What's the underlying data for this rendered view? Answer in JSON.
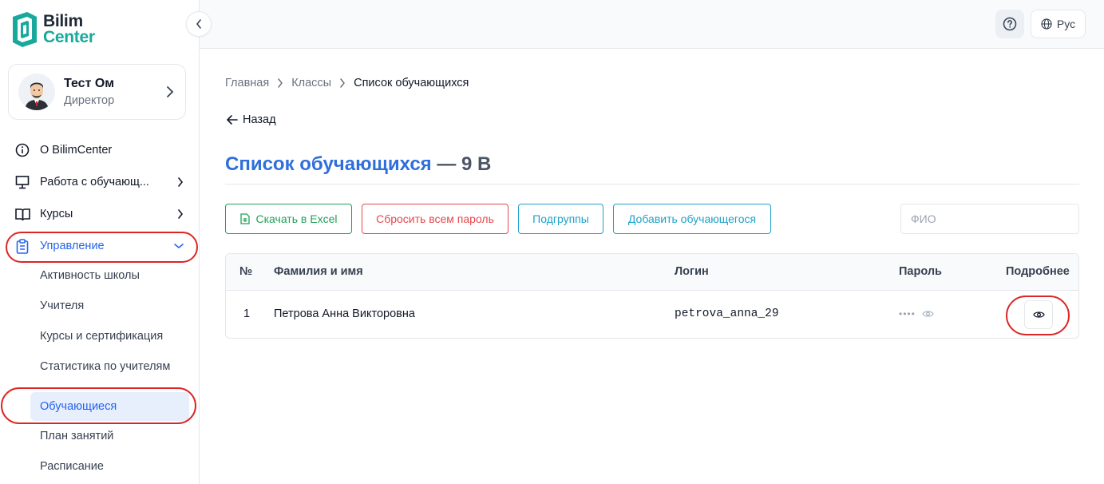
{
  "brand": {
    "line1": "Bilim",
    "line2": "Center"
  },
  "profile": {
    "name": "Тест Ом",
    "role": "Директор"
  },
  "nav": [
    {
      "label": "О BilimCenter",
      "icon": "info-icon"
    },
    {
      "label": "Работа с обучающ...",
      "icon": "presentation-icon"
    },
    {
      "label": "Курсы",
      "icon": "book-open-icon"
    },
    {
      "label": "Управление",
      "icon": "clipboard-icon"
    }
  ],
  "subnav": [
    {
      "label": "Активность школы"
    },
    {
      "label": "Учителя"
    },
    {
      "label": "Курсы и сертификация"
    },
    {
      "label": "Статистика по учителям"
    },
    {
      "label": "Обучающиеся"
    },
    {
      "label": "План занятий"
    },
    {
      "label": "Расписание"
    }
  ],
  "topbar": {
    "language": "Рус"
  },
  "breadcrumb": [
    "Главная",
    "Классы",
    "Список обучающихся"
  ],
  "back_label": "Назад",
  "title": {
    "main": "Список обучающихся",
    "suffix": " — 9 В"
  },
  "actions": {
    "excel": "Скачать в Excel",
    "reset": "Сбросить всем пароль",
    "subgroups": "Подгруппы",
    "add": "Добавить обучающегося"
  },
  "search": {
    "placeholder": "ФИО",
    "value": ""
  },
  "table": {
    "columns": [
      "№",
      "Фамилия и имя",
      "Логин",
      "Пароль",
      "Подробнее"
    ],
    "rows": [
      {
        "num": "1",
        "name": "Петрова Анна Викторовна",
        "login": "petrova_anna_29",
        "password": "••••"
      }
    ]
  },
  "colors": {
    "accent": "#2563eb",
    "brand_teal": "#19a99c",
    "annotation": "#dc2626"
  }
}
